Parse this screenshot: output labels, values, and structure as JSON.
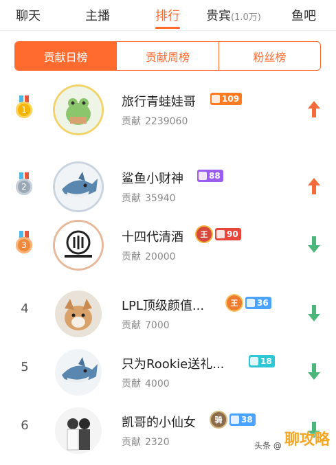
{
  "topnav": {
    "tabs": [
      {
        "label": "聊天",
        "sub": ""
      },
      {
        "label": "主播",
        "sub": ""
      },
      {
        "label": "排行",
        "sub": ""
      },
      {
        "label": "贵宾",
        "sub": "(1.0万)"
      },
      {
        "label": "鱼吧",
        "sub": ""
      }
    ],
    "active_index": 2,
    "accent_color": "#ff6a2e"
  },
  "segments": {
    "items": [
      "贡献日榜",
      "贡献周榜",
      "粉丝榜"
    ],
    "active_index": 0
  },
  "contrib_label": "贡献",
  "list": [
    {
      "rank": "1",
      "medal": "gold",
      "name": "旅行青蛙娃哥",
      "contribution": "2239060",
      "badges": [
        {
          "color": "orange",
          "text": "109"
        }
      ],
      "crown": null,
      "trend": "up",
      "avatar_icon": "frog-avatar-icon"
    },
    {
      "rank": "2",
      "medal": "silver",
      "name": "鲨鱼小财神",
      "contribution": "35940",
      "badges": [
        {
          "color": "purple",
          "text": "88"
        }
      ],
      "crown": null,
      "trend": "up",
      "avatar_icon": "shark-avatar-icon"
    },
    {
      "rank": "3",
      "medal": "bronze",
      "name": "十四代清酒",
      "contribution": "20000",
      "badges": [
        {
          "color": "red",
          "text": "90"
        }
      ],
      "crown": {
        "color": "red",
        "text": "王"
      },
      "trend": "down",
      "avatar_icon": "invictus-logo-avatar-icon"
    },
    {
      "rank": "4",
      "medal": "",
      "name": "LPL顶级颜值...",
      "contribution": "7000",
      "badges": [
        {
          "color": "blue",
          "text": "36"
        }
      ],
      "crown": {
        "color": "orange",
        "text": "王"
      },
      "trend": "down",
      "avatar_icon": "dog-avatar-icon"
    },
    {
      "rank": "5",
      "medal": "",
      "name": "只为Rookie送礼...",
      "contribution": "4000",
      "badges": [
        {
          "color": "cyan",
          "text": "18"
        }
      ],
      "crown": null,
      "trend": "down",
      "avatar_icon": "shark-avatar-icon"
    },
    {
      "rank": "6",
      "medal": "",
      "name": "凯哥的小仙女",
      "contribution": "2320",
      "badges": [
        {
          "color": "blue",
          "text": "38"
        }
      ],
      "crown": {
        "color": "brown",
        "text": "骑"
      },
      "trend": "down",
      "avatar_icon": "couple-photo-avatar-icon"
    }
  ],
  "trend_colors": {
    "up": "#f26b3a",
    "down": "#4cb67a"
  },
  "watermark": {
    "small": "头条 @",
    "big": "聊攻略"
  }
}
